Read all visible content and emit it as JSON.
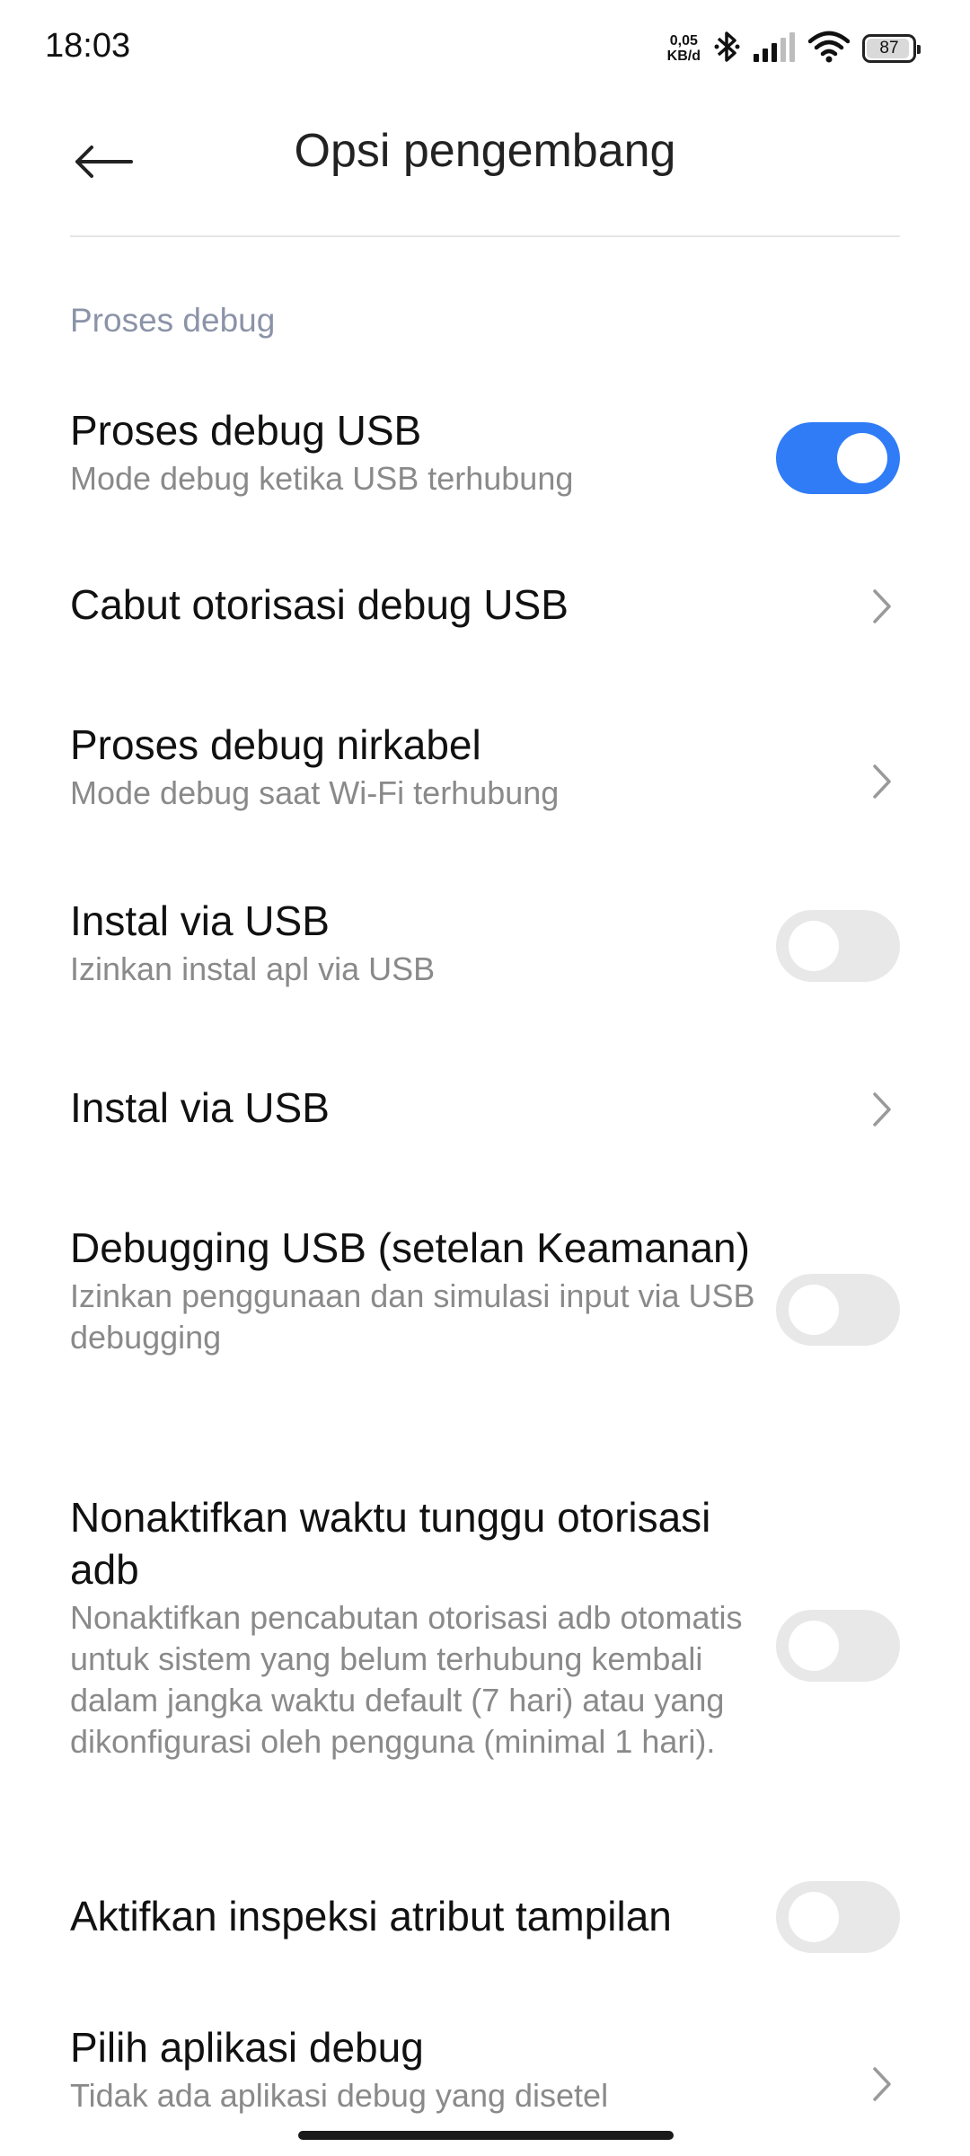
{
  "status_bar": {
    "time": "18:03",
    "net_speed_value": "0,05",
    "net_speed_unit": "KB/d",
    "battery_level": "87",
    "icons": [
      "bluetooth-icon",
      "signal-icon",
      "wifi-icon",
      "battery-icon"
    ]
  },
  "header": {
    "title": "Opsi pengembang",
    "back_icon": "arrow-left-icon"
  },
  "section": {
    "title": "Proses debug"
  },
  "colors": {
    "accent": "#2f7cf6",
    "section_title": "#8b93a8",
    "subtitle": "#8a8a8a",
    "toggle_off": "#e8e8e8"
  },
  "items": [
    {
      "title": "Proses debug USB",
      "subtitle": "Mode debug ketika USB terhubung",
      "control": "toggle",
      "checked": true
    },
    {
      "title": "Cabut otorisasi debug USB",
      "subtitle": "",
      "control": "chevron"
    },
    {
      "title": "Proses debug nirkabel",
      "subtitle": "Mode debug saat Wi-Fi terhubung",
      "control": "chevron"
    },
    {
      "title": "Instal via USB",
      "subtitle": "Izinkan instal apl via USB",
      "control": "toggle",
      "checked": false
    },
    {
      "title": "Instal via USB",
      "subtitle": "",
      "control": "chevron"
    },
    {
      "title": "Debugging USB (setelan Keamanan)",
      "subtitle": "Izinkan penggunaan dan simulasi input via USB debugging",
      "control": "toggle",
      "checked": false
    },
    {
      "title": "Nonaktifkan waktu tunggu otorisasi adb",
      "subtitle": "Nonaktifkan pencabutan otorisasi adb otomatis untuk sistem yang belum terhubung kembali dalam jangka waktu default (7 hari) atau yang dikonfigurasi oleh pengguna (minimal 1 hari).",
      "control": "toggle",
      "checked": false
    },
    {
      "title": "Aktifkan inspeksi atribut tampilan",
      "subtitle": "",
      "control": "toggle",
      "checked": false
    },
    {
      "title": "Pilih aplikasi debug",
      "subtitle": "Tidak ada aplikasi debug yang disetel",
      "control": "chevron"
    }
  ]
}
